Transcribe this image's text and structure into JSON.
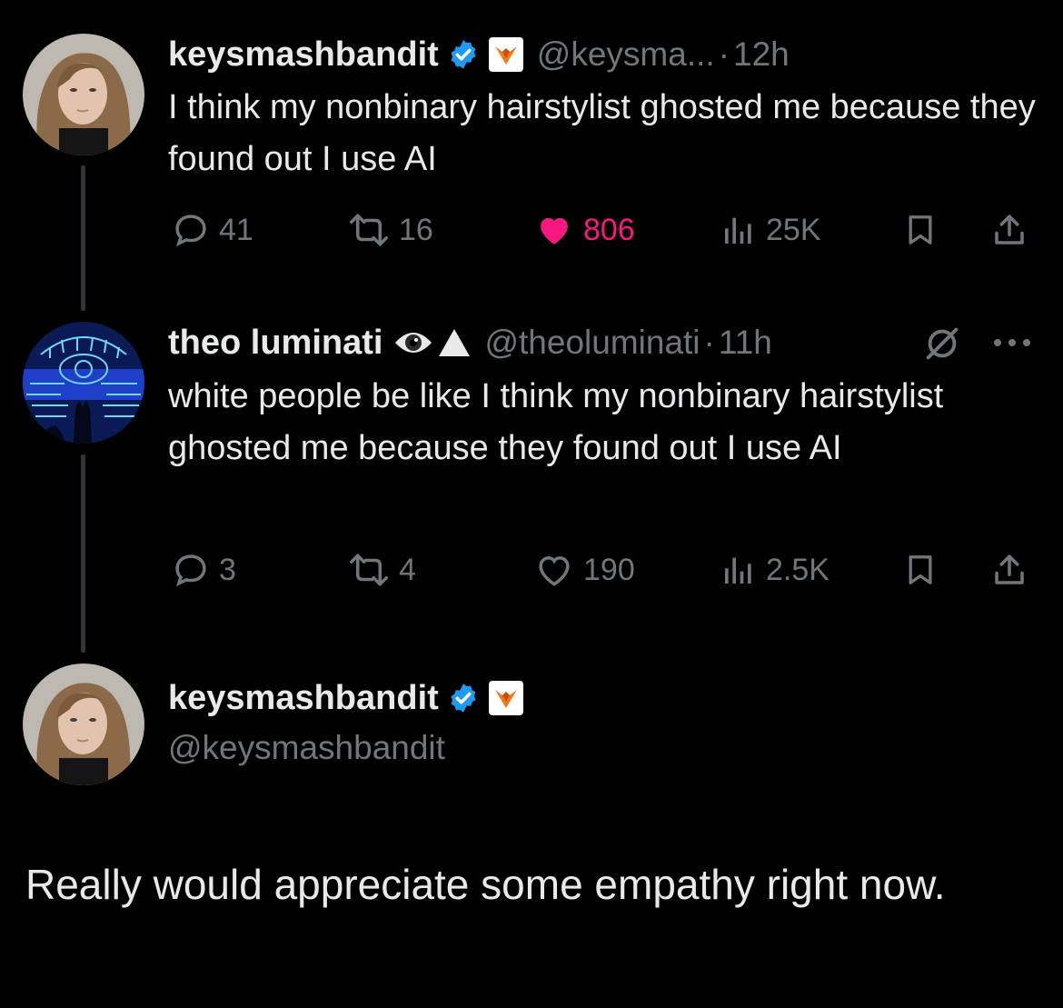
{
  "tweets": [
    {
      "name": "keysmashbandit",
      "handle": "@keysma...",
      "separator": "·",
      "time": "12h",
      "text": "I think my nonbinary hairstylist ghosted me because they found out I use AI",
      "replies": "41",
      "retweets": "16",
      "likes": "806",
      "views": "25K",
      "liked": true
    },
    {
      "name": "theo luminati",
      "handle": "@theoluminati",
      "separator": "·",
      "time": "11h",
      "text": "white people be like I think my nonbinary hairstylist ghosted me because they found out I use AI",
      "replies": "3",
      "retweets": "4",
      "likes": "190",
      "views": "2.5K",
      "liked": false
    }
  ],
  "main_post": {
    "name": "keysmashbandit",
    "handle": "@keysmashbandit",
    "text": "Really would appreciate some empathy right now."
  },
  "icons": {
    "verified": "verified-badge-icon",
    "org": "fox-badge-icon",
    "reply": "reply-icon",
    "retweet": "retweet-icon",
    "like": "heart-icon",
    "views": "views-icon",
    "bookmark": "bookmark-icon",
    "share": "share-icon",
    "grok": "grok-icon",
    "more": "more-icon",
    "eye": "eye-emoji-icon",
    "triangle": "triangle-emoji-icon"
  },
  "colors": {
    "background": "#000000",
    "text": "#e7e9ea",
    "muted": "#71767b",
    "like": "#f91880",
    "verified": "#1d9bf0"
  }
}
